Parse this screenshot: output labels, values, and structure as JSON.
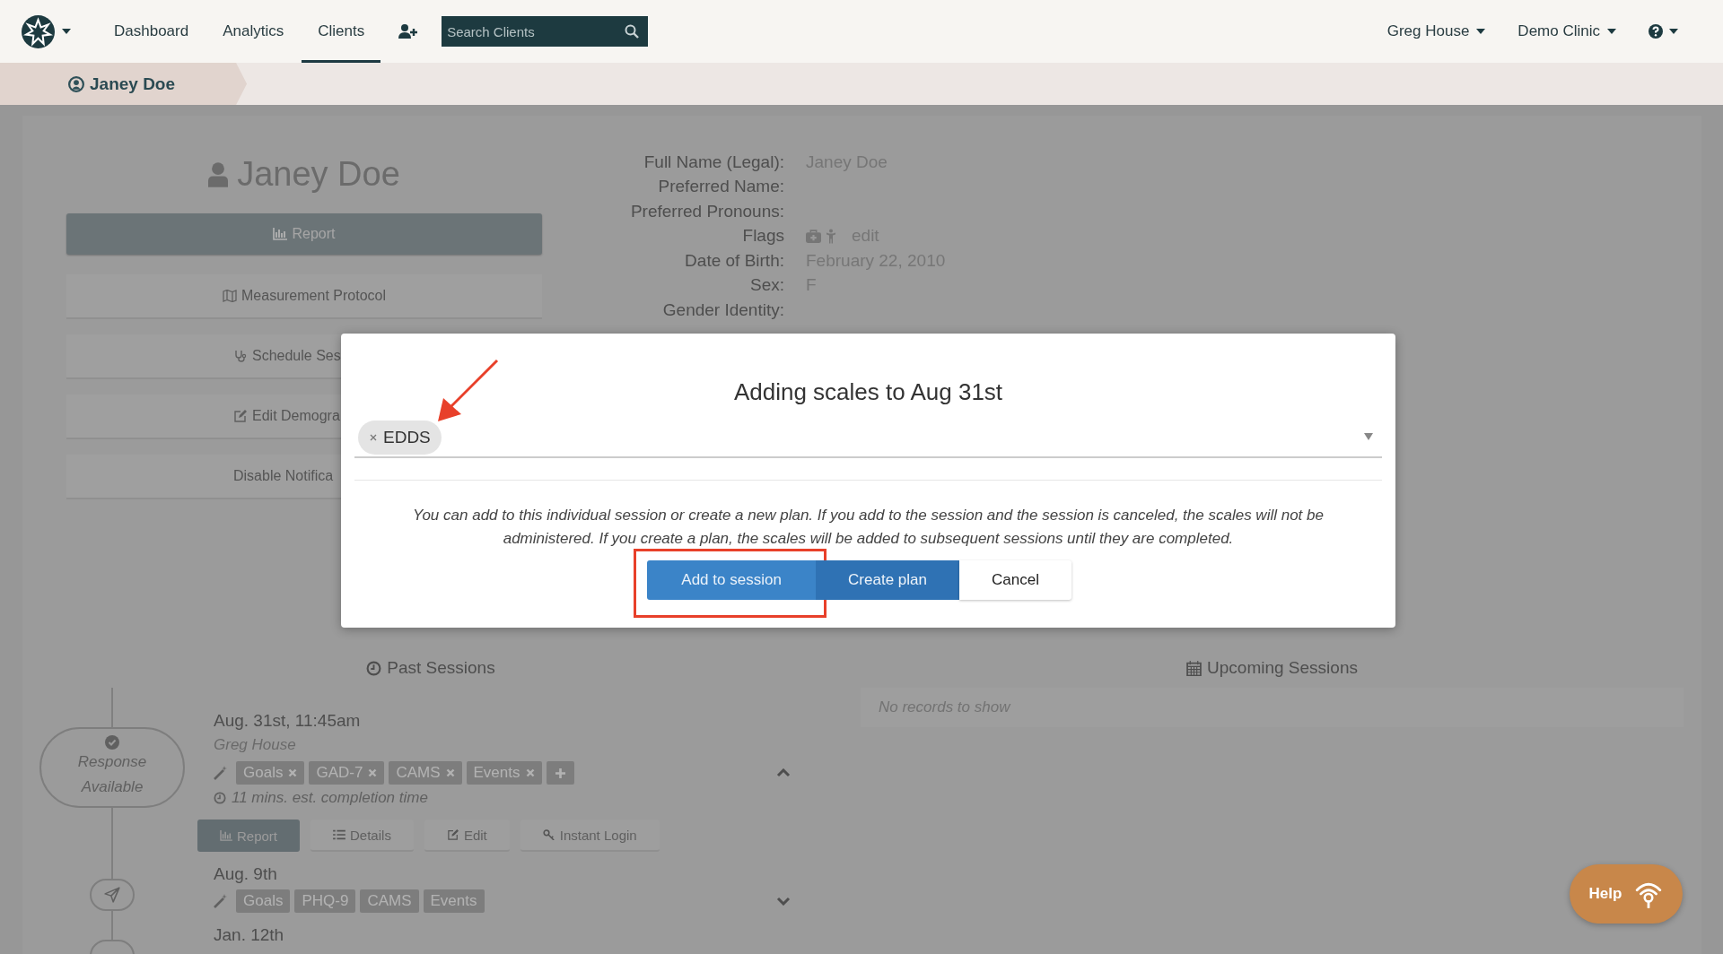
{
  "nav": {
    "links": [
      {
        "label": "Dashboard",
        "selected": false
      },
      {
        "label": "Analytics",
        "selected": false
      },
      {
        "label": "Clients",
        "selected": true
      }
    ],
    "search": {
      "placeholder": "Search Clients"
    },
    "menus": [
      "Greg House",
      "Demo Clinic"
    ]
  },
  "breadcrumb": {
    "label": "Janey Doe"
  },
  "profile": {
    "name": "Janey Doe",
    "actions": [
      {
        "label": "Report",
        "kind": "primary"
      },
      {
        "label": "Measurement Protocol",
        "kind": "default"
      },
      {
        "label": "Schedule Ses",
        "kind": "default"
      },
      {
        "label": "Edit Demogra",
        "kind": "default"
      },
      {
        "label": "Disable Notifica",
        "kind": "default"
      }
    ],
    "fields": [
      {
        "label": "Full Name (Legal):",
        "value": "Janey Doe"
      },
      {
        "label": "Preferred Name:"
      },
      {
        "label": "Preferred Pronouns:"
      },
      {
        "label": "Flags",
        "kind": "flags",
        "value": "edit"
      },
      {
        "label": "Date of Birth:",
        "value": "February 22, 2010"
      },
      {
        "label": "Sex:",
        "value": "F"
      },
      {
        "label": "Gender Identity:"
      }
    ]
  },
  "past_sessions": {
    "title": "Past Sessions",
    "items": [
      {
        "date": "Aug. 31st, 11:45am",
        "clinician": "Greg House",
        "marker": {
          "kind": "response",
          "label": "Response Available"
        },
        "tags": [
          {
            "label": "Goals",
            "removable": true
          },
          {
            "label": "GAD-7",
            "removable": true
          },
          {
            "label": "CAMS",
            "removable": true
          },
          {
            "label": "Events",
            "removable": true
          }
        ],
        "can_add": true,
        "completion": "11 mins. est. completion time",
        "actions": [
          {
            "label": "Report",
            "kind": "primary"
          },
          {
            "label": "Details",
            "kind": "default"
          },
          {
            "label": "Edit",
            "kind": "default"
          },
          {
            "label": "Instant Login",
            "kind": "default"
          }
        ],
        "expanded": true
      },
      {
        "date": "Aug. 9th",
        "marker": {
          "kind": "sent"
        },
        "tags": [
          {
            "label": "Goals",
            "removable": false
          },
          {
            "label": "PHQ-9",
            "removable": false
          },
          {
            "label": "CAMS",
            "removable": false
          },
          {
            "label": "Events",
            "removable": false
          }
        ],
        "can_add": false,
        "expanded": false
      },
      {
        "date": "Jan. 12th",
        "marker": {
          "kind": "pending"
        }
      }
    ]
  },
  "upcoming_sessions": {
    "title": "Upcoming Sessions",
    "empty": "No records to show"
  },
  "modal": {
    "title": "Adding scales to Aug 31st",
    "chips": [
      {
        "label": "EDDS"
      }
    ],
    "note": "You can add to this individual session or create a new plan. If you add to the session and the session is canceled, the scales will not be administered. If you create a plan, the scales will be added to subsequent sessions until they are completed.",
    "buttons": [
      {
        "label": "Add to session",
        "kind": "primary",
        "highlighted": true
      },
      {
        "label": "Create plan",
        "kind": "secondary",
        "highlighted": false
      },
      {
        "label": "Cancel",
        "kind": "default",
        "highlighted": false
      }
    ]
  },
  "help": {
    "label": "Help"
  }
}
